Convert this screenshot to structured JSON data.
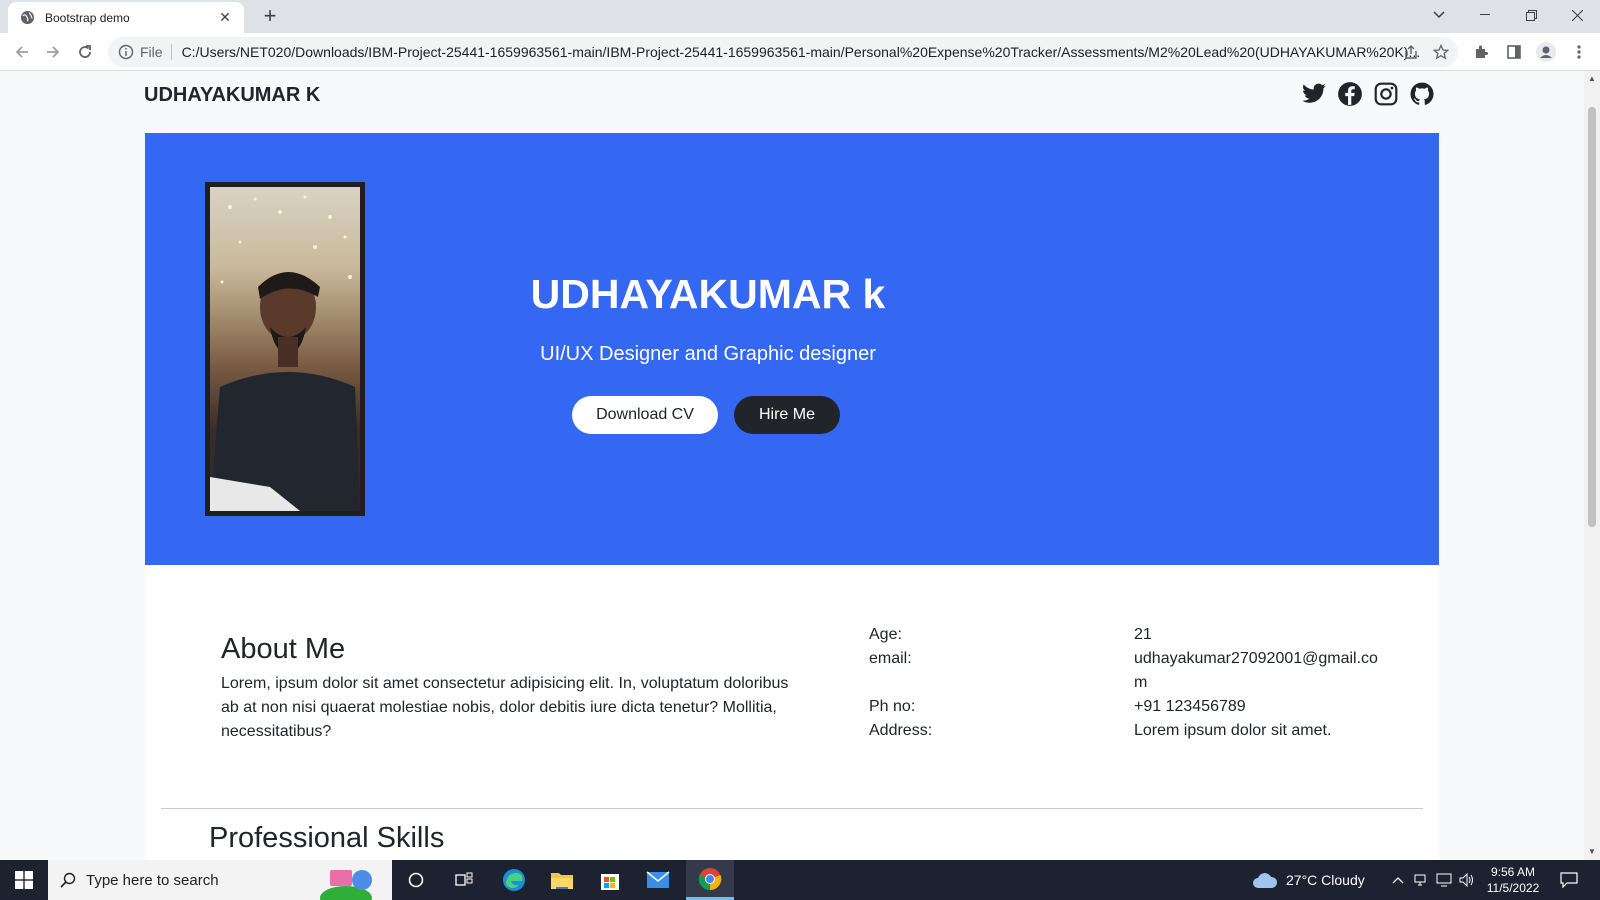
{
  "browser": {
    "tab_title": "Bootstrap demo",
    "file_label": "File",
    "url": "C:/Users/NET020/Downloads/IBM-Project-25441-1659963561-main/IBM-Project-25441-1659963561-main/Personal%20Expense%20Tracker/Assessments/M2%20Lead%20(UDHAYAKUMAR%20K)..."
  },
  "site": {
    "brand": "UDHAYAKUMAR K",
    "social_icons": [
      "twitter-icon",
      "facebook-icon",
      "instagram-icon",
      "github-icon"
    ]
  },
  "hero": {
    "name": "UDHAYAKUMAR k",
    "role": "UI/UX Designer and Graphic designer",
    "download_cv": "Download CV",
    "hire_me": "Hire Me",
    "background_color": "#3468f3"
  },
  "about": {
    "title": "About Me",
    "text": "Lorem, ipsum dolor sit amet consectetur adipisicing elit. In, voluptatum doloribus ab at non nisi quaerat molestiae nobis, dolor debitis iure dicta tenetur? Mollitia, necessitatibus?",
    "info": [
      {
        "label": "Age:",
        "value": "21"
      },
      {
        "label": "email:",
        "value": "udhayakumar27092001@gmail.com"
      },
      {
        "label": "Ph no:",
        "value": "+91 123456789"
      },
      {
        "label": "Address:",
        "value": "Lorem ipsum dolor sit amet."
      }
    ]
  },
  "skills": {
    "title": "Professional Skills"
  },
  "taskbar": {
    "search_placeholder": "Type here to search",
    "weather": "27°C  Cloudy",
    "time": "9:56 AM",
    "date": "11/5/2022"
  }
}
